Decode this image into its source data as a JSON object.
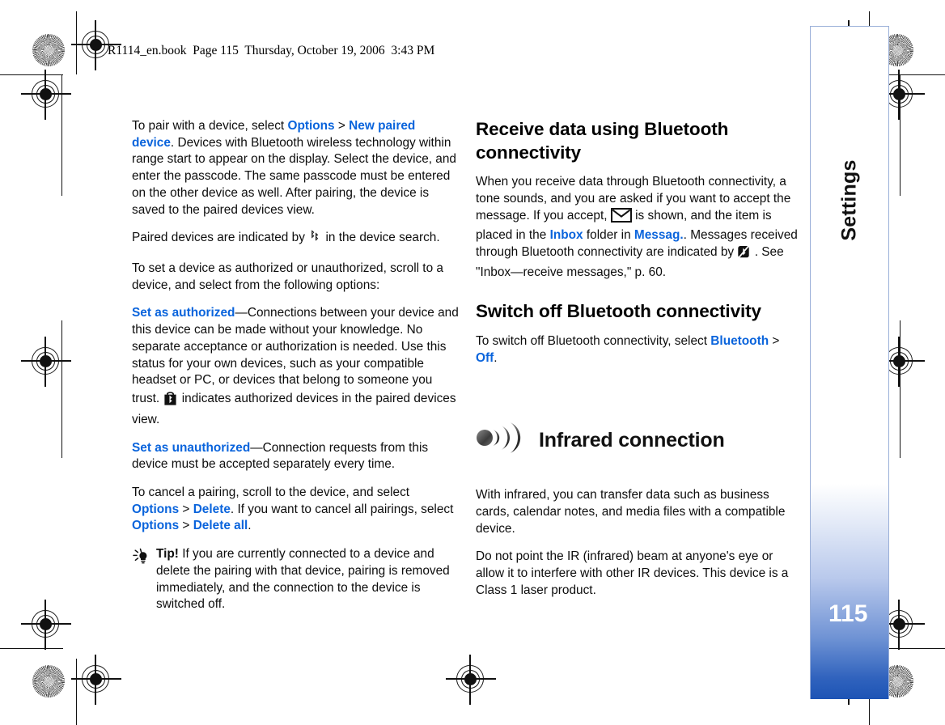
{
  "header": {
    "file_line": "R1114_en.book  Page 115  Thursday, October 19, 2006  3:43 PM"
  },
  "side_tab": {
    "label": "Settings",
    "page_number": "115",
    "accent_color": "#1d54b5",
    "border_color": "#9aafd8"
  },
  "colors": {
    "link": "#0a64dc",
    "text": "#0d0d0d"
  },
  "left_column": {
    "p1": {
      "t1": "To pair with a device, select ",
      "link1": "Options",
      "gt1": " > ",
      "link2": "New paired device",
      "t2": ". Devices with Bluetooth wireless technology within range start to appear on the display. Select the device, and enter the passcode. The same passcode must be entered on the other device as well. After pairing, the device is saved to the paired devices view."
    },
    "p2": {
      "t1": "Paired devices are indicated by ",
      "icon": "bluetooth-paired-icon",
      "t2": "  in the device search."
    },
    "p3": {
      "t1": "To set a device as authorized or unauthorized, scroll to a device, and select from the following options:"
    },
    "p4": {
      "link1": "Set as authorized",
      "t1": "—Connections between your device and this device can be made without your knowledge. No separate acceptance or authorization is needed. Use this status for your own devices, such as your compatible headset or PC, or devices that belong to someone you trust. ",
      "icon": "bluetooth-authorized-icon",
      "t2": "  indicates authorized devices in the paired devices view."
    },
    "p5": {
      "link1": "Set as unauthorized",
      "t1": "—Connection requests from this device must be accepted separately every time."
    },
    "p6": {
      "t1": "To cancel a pairing, scroll to the device, and select ",
      "link1": "Options",
      "gt1": " > ",
      "link2": "Delete",
      "t2": ". If you want to cancel all pairings, select ",
      "link3": "Options",
      "gt2": " > ",
      "link4": "Delete all",
      "t3": "."
    },
    "tip": {
      "icon": "lightbulb-tip-icon",
      "word": "Tip!",
      "text": " If you are currently connected to a device and delete the pairing with that device, pairing is removed immediately, and the connection to the device is switched off."
    }
  },
  "right_column": {
    "heading1": "Receive data using Bluetooth connectivity",
    "p1": {
      "t1": "When you receive data through Bluetooth connectivity, a tone sounds, and you are asked if you want to accept the message. If you accept, ",
      "icon1": "envelope-icon",
      "t2": " is shown, and the item is placed in the ",
      "link1": "Inbox",
      "t3": " folder in ",
      "link2": "Messag.",
      "t4": ". Messages received through Bluetooth connectivity are indicated by ",
      "icon2": "bluetooth-received-icon",
      "t5": " . See \"Inbox—receive messages,\" p. 60."
    },
    "heading2": "Switch off Bluetooth connectivity",
    "p2": {
      "t1": "To switch off Bluetooth connectivity, select ",
      "link1": "Bluetooth",
      "gt1": " > ",
      "link2": "Off",
      "t2": "."
    },
    "chapter": {
      "icon": "infrared-signal-icon",
      "title": "Infrared connection"
    },
    "p3": {
      "t1": "With infrared, you can transfer data such as business cards, calendar notes, and media files with a compatible device."
    },
    "p4": {
      "t1": "Do not point the IR (infrared) beam at anyone's eye or allow it to interfere with other IR devices. This device is a Class 1 laser product."
    }
  }
}
